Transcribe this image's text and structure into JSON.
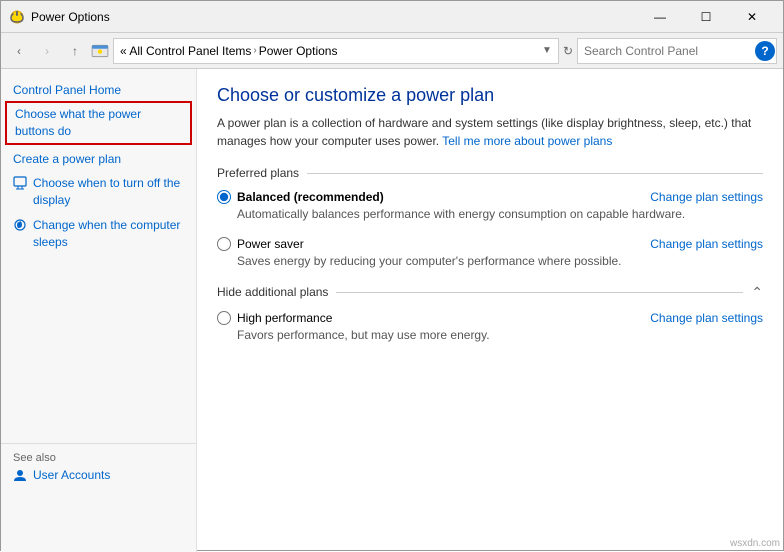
{
  "titleBar": {
    "title": "Power Options",
    "iconColor": "#ffd700",
    "controls": {
      "minimize": "—",
      "maximize": "☐",
      "close": "✕"
    }
  },
  "addressBar": {
    "back": "‹",
    "forward": "›",
    "up": "↑",
    "breadcrumb": {
      "root": "«  All Control Panel Items",
      "separator": "›",
      "current": "Power Options"
    },
    "refreshIcon": "↻",
    "search": {
      "placeholder": "Search Control Panel",
      "icon": "🔍"
    }
  },
  "sidebar": {
    "homeLabel": "Control Panel Home",
    "items": [
      {
        "label": "Choose what the power buttons do",
        "highlighted": true,
        "icon": "⚡"
      },
      {
        "label": "Create a power plan",
        "highlighted": false,
        "icon": ""
      },
      {
        "label": "Choose when to turn off the display",
        "highlighted": false,
        "icon": "🖥"
      },
      {
        "label": "Change when the computer sleeps",
        "highlighted": false,
        "icon": "💤"
      }
    ],
    "seeAlso": {
      "label": "See also",
      "items": [
        {
          "label": "User Accounts",
          "icon": "👤"
        }
      ]
    }
  },
  "content": {
    "title": "Choose or customize a power plan",
    "description": "A power plan is a collection of hardware and system settings (like display brightness, sleep, etc.) that manages how your computer uses power.",
    "learnMoreLink": "Tell me more about power plans",
    "preferredPlans": {
      "sectionLabel": "Preferred plans",
      "plans": [
        {
          "name": "Balanced (recommended)",
          "bold": true,
          "selected": true,
          "description": "Automatically balances performance with energy consumption on capable hardware.",
          "changeLink": "Change plan settings"
        },
        {
          "name": "Power saver",
          "bold": false,
          "selected": false,
          "description": "Saves energy by reducing your computer's performance where possible.",
          "changeLink": "Change plan settings"
        }
      ]
    },
    "additionalPlans": {
      "sectionLabel": "Hide additional plans",
      "collapsed": false,
      "plans": [
        {
          "name": "High performance",
          "bold": false,
          "selected": false,
          "description": "Favors performance, but may use more energy.",
          "changeLink": "Change plan settings"
        }
      ]
    }
  },
  "watermark": "wsxdn.com"
}
